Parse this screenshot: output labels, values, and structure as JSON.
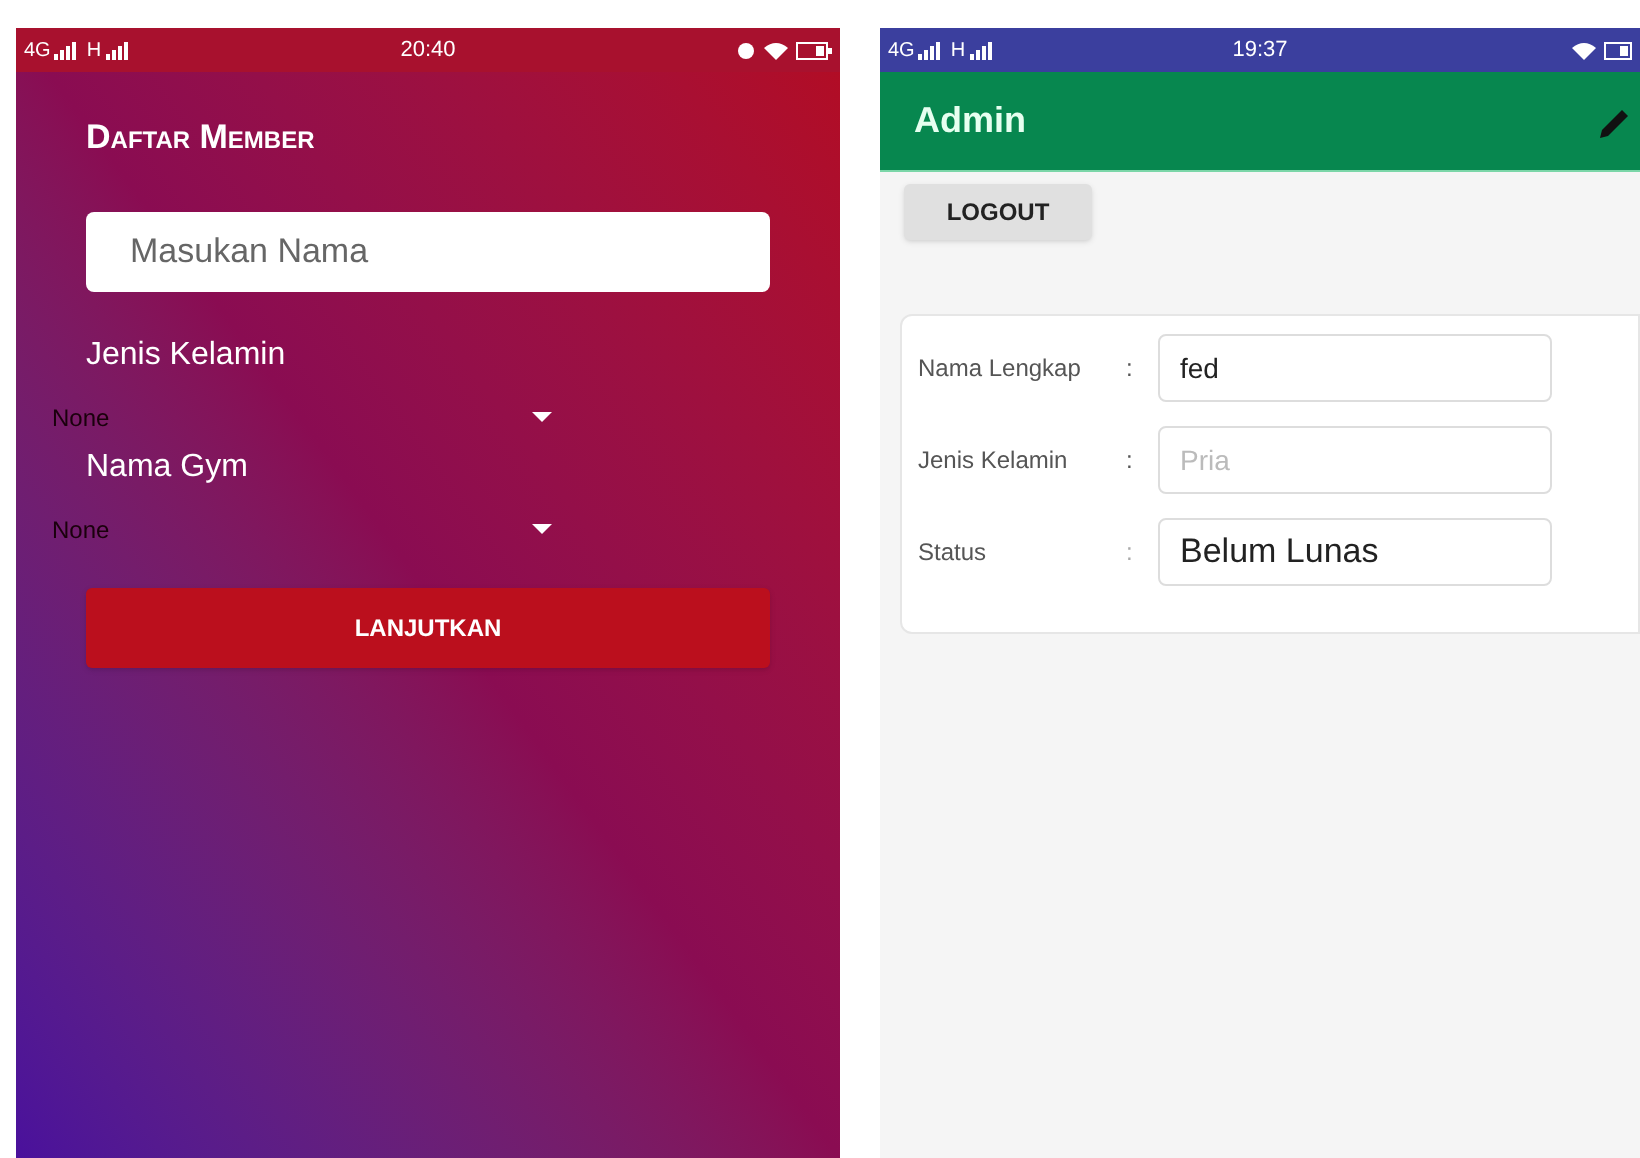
{
  "left_screen": {
    "status_bar": {
      "network": "4G",
      "network_2": "H",
      "time": "20:40"
    },
    "title": "Daftar Member",
    "name_field": {
      "placeholder": "Masukan Nama"
    },
    "selects": [
      {
        "label": "Jenis Kelamin",
        "value": "None"
      },
      {
        "label": "Nama Gym",
        "value": "None"
      }
    ],
    "button": "LANJUTKAN"
  },
  "right_screen": {
    "status_bar": {
      "network": "4G",
      "network_2": "H",
      "time": "19:37"
    },
    "toolbar_title": "Admin",
    "logout_button": "LOGOUT",
    "fields": [
      {
        "label": "Nama Lengkap",
        "separator": ":",
        "value": "fed"
      },
      {
        "label": "Jenis Kelamin",
        "separator": ":",
        "placeholder": "Pria"
      },
      {
        "label": "Status",
        "separator": ":",
        "value": "Belum Lunas"
      }
    ]
  }
}
